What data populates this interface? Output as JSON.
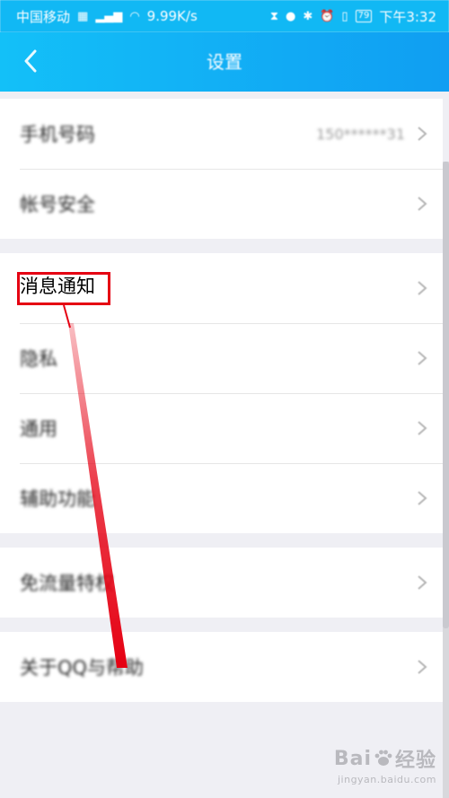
{
  "status_bar": {
    "carrier": "中国移动",
    "network_speed": "9.99K/s",
    "battery": "79",
    "time": "下午3:32",
    "left_icons": [
      "sim-icon",
      "signal-icon",
      "wifi-icon"
    ],
    "right_icons": [
      "hourglass-icon",
      "chat-bubble-icon",
      "bluetooth-icon",
      "alarm-icon",
      "vibrate-icon"
    ]
  },
  "header": {
    "title": "设置",
    "back_icon": "chevron-left-icon",
    "background": "#11b8f4"
  },
  "settings": {
    "group1": [
      {
        "label": "手机号码",
        "value": "150******31"
      },
      {
        "label": "帐号安全",
        "value": ""
      }
    ],
    "group2": [
      {
        "label": "消息通知",
        "value": ""
      },
      {
        "label": "隐私",
        "value": ""
      },
      {
        "label": "通用",
        "value": ""
      },
      {
        "label": "辅助功能",
        "value": ""
      }
    ],
    "group3": [
      {
        "label": "免流量特权",
        "value": ""
      }
    ],
    "group4": [
      {
        "label": "关于QQ与帮助",
        "value": ""
      }
    ]
  },
  "annotation": {
    "highlight_color": "#e50012",
    "highlighted_item": "消息通知"
  },
  "watermark": {
    "brand": "Baidu经验",
    "brand_left": "Bai",
    "brand_right": "经验",
    "url": "jingyan.baidu.com"
  },
  "colors": {
    "accent": "#11b8f4",
    "page_bg": "#efeff4",
    "row_bg": "#ffffff",
    "annotation_red": "#e50012"
  }
}
